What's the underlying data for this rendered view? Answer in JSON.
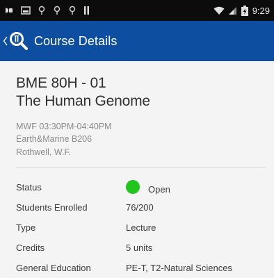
{
  "status_bar": {
    "time": "9:29",
    "icons": [
      "usb-debug-icon",
      "image-notification-icon",
      "location-icon",
      "location-icon",
      "location-icon",
      "bars-icon",
      "wifi-icon",
      "signal-icon",
      "battery-charging-icon"
    ]
  },
  "app_bar": {
    "title": "Course Details",
    "color": "#0d4ea1"
  },
  "course": {
    "code": "BME 80H - 01",
    "name": "The Human Genome",
    "schedule": "MWF 03:30PM-04:40PM",
    "location": "Earth&Marine B206",
    "instructor": "Rothwell, W.F."
  },
  "details": {
    "status_label": "Status",
    "status_value": "Open",
    "status_color": "#22c51e",
    "enrolled_label": "Students Enrolled",
    "enrolled_value": "76/200",
    "type_label": "Type",
    "type_value": "Lecture",
    "credits_label": "Credits",
    "credits_value": "5 units",
    "ge_label": "General Education",
    "ge_value": "PE-T, T2-Natural Sciences"
  }
}
